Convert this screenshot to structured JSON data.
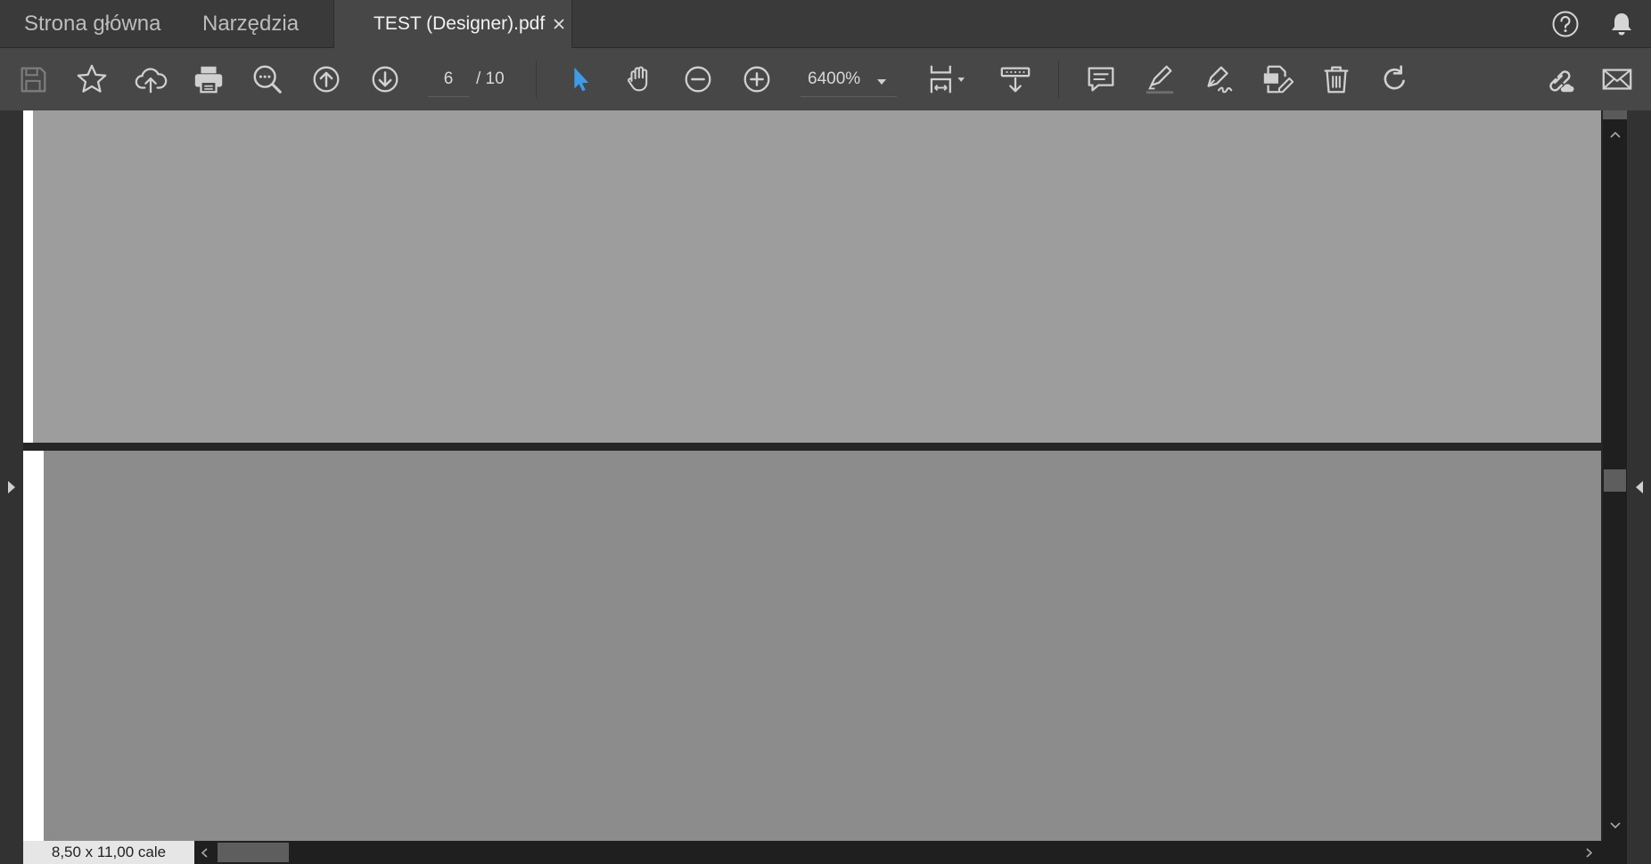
{
  "tabs": {
    "home": "Strona główna",
    "tools": "Narzędzia",
    "document": "TEST (Designer).pdf"
  },
  "header_icons": [
    "help-icon",
    "bell-icon"
  ],
  "toolbar": {
    "page_current": "6",
    "page_total": "/ 10",
    "zoom": "6400%",
    "icons": [
      "save-icon",
      "star-icon",
      "cloud-upload-icon",
      "print-icon",
      "search-zoom-icon",
      "arrow-up-circle-icon",
      "arrow-down-circle-icon",
      "cursor-select-icon",
      "hand-icon",
      "zoom-out-icon",
      "zoom-in-icon",
      "fit-page-icon",
      "scroll-mode-icon",
      "comment-icon",
      "highlight-icon",
      "sign-icon",
      "edit-pdf-icon",
      "trash-icon",
      "rotate-icon",
      "share-link-icon",
      "email-icon"
    ]
  },
  "status": {
    "page_size": "8,50 x 11,00 cale"
  },
  "colors": {
    "accent": "#3d9be9",
    "toolbar_bg": "#474747",
    "tabbar_bg": "#3a3a3a",
    "icon": "#cfcfcf"
  }
}
